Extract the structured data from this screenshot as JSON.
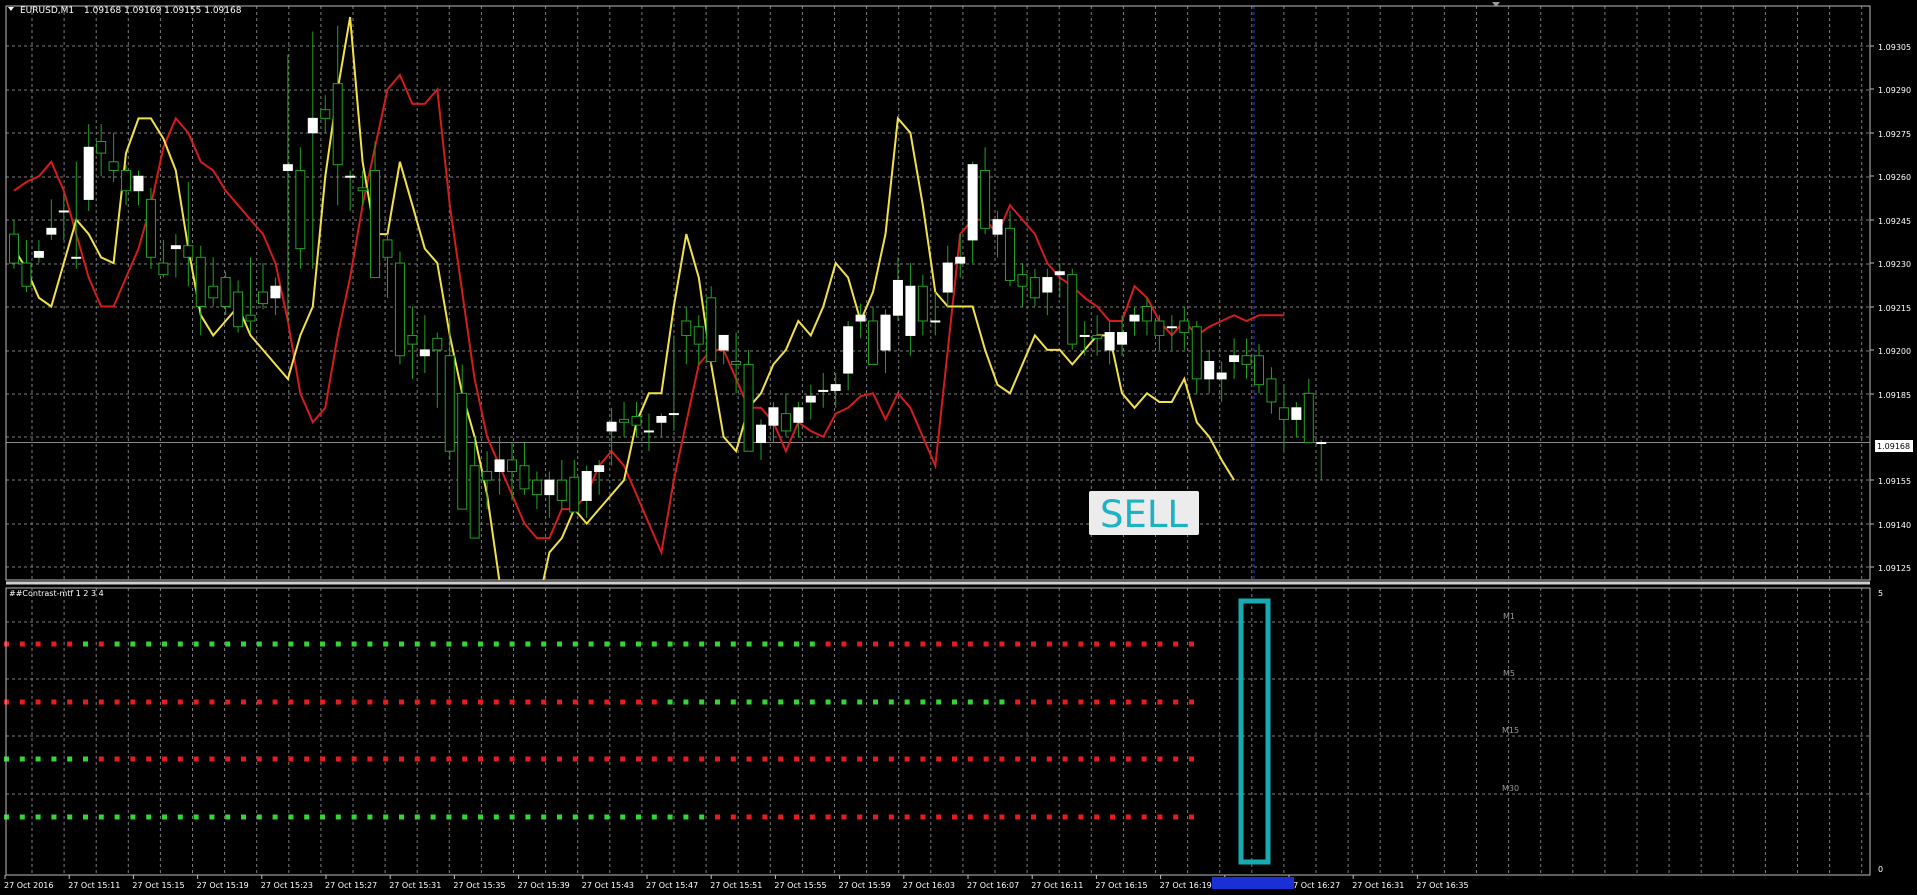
{
  "window": {
    "title": "EURUSD,M1",
    "ohlc": "1.09168 1.09169 1.09155 1.09168"
  },
  "indicator": {
    "title": "##Contrast-mtf 1 2 3 4",
    "scale_top": "5",
    "scale_bottom": "0",
    "rows": [
      {
        "label": "M1",
        "pattern": [
          "red",
          5,
          "green",
          1,
          "red",
          1,
          "green",
          45,
          "red",
          24
        ]
      },
      {
        "label": "M5",
        "pattern": [
          "red",
          42,
          "green",
          22,
          "red",
          12
        ]
      },
      {
        "label": "M15",
        "pattern": [
          "green",
          6,
          "red",
          70
        ]
      },
      {
        "label": "M30",
        "pattern": [
          "green",
          45,
          "red",
          31
        ]
      }
    ]
  },
  "price_axis": {
    "labels": [
      "1.09305",
      "1.09290",
      "1.09275",
      "1.09260",
      "1.09245",
      "1.09230",
      "1.09215",
      "1.09200",
      "1.09185",
      "1.09155",
      "1.09140",
      "1.09125"
    ],
    "current": "1.09168"
  },
  "time_axis": {
    "labels": [
      "27 Oct 2016",
      "27 Oct 15:11",
      "27 Oct 15:15",
      "27 Oct 15:19",
      "27 Oct 15:23",
      "27 Oct 15:27",
      "27 Oct 15:31",
      "27 Oct 15:35",
      "27 Oct 15:39",
      "27 Oct 15:43",
      "27 Oct 15:47",
      "27 Oct 15:51",
      "27 Oct 15:55",
      "27 Oct 15:59",
      "27 Oct 16:03",
      "27 Oct 16:07",
      "27 Oct 16:11",
      "27 Oct 16:15",
      "27 Oct 16:19",
      "27 Oct 16:23",
      "27 Oct 16:27",
      "27 Oct 16:31",
      "27 Oct 16:35"
    ]
  },
  "signal": {
    "label": "SELL"
  },
  "colors": {
    "background": "#000000",
    "grid": "#7c7c7c",
    "bull_candle": "#ffffff",
    "bear_candle": "#000000",
    "wick": "#21a321",
    "red_line": "#d31d1d",
    "yellow_line": "#f2e14a",
    "dot_red": "#e81c1c",
    "dot_green": "#33d633",
    "highlight": "#17aab3",
    "sell_text": "#1cb4c4",
    "sell_bg": "#ececec"
  },
  "chart_data": {
    "type": "candlestick",
    "symbol": "EURUSD",
    "timeframe": "M1",
    "ylim": [
      1.0912,
      1.0932
    ],
    "candles": [
      [
        1.0924,
        1.09245,
        1.09228,
        1.0923
      ],
      [
        1.0923,
        1.09238,
        1.0922,
        1.09222
      ],
      [
        1.09232,
        1.09238,
        1.0923,
        1.09234
      ],
      [
        1.0924,
        1.09252,
        1.09238,
        1.09242
      ],
      [
        1.09248,
        1.09254,
        1.09238,
        1.09248
      ],
      [
        1.09232,
        1.09265,
        1.09228,
        1.09232
      ],
      [
        1.09252,
        1.09278,
        1.09248,
        1.0927
      ],
      [
        1.09272,
        1.09278,
        1.0926,
        1.09268
      ],
      [
        1.09265,
        1.09275,
        1.09258,
        1.09262
      ],
      [
        1.09262,
        1.09264,
        1.0925,
        1.09255
      ],
      [
        1.09255,
        1.09262,
        1.0925,
        1.0926
      ],
      [
        1.09252,
        1.09256,
        1.09228,
        1.09232
      ],
      [
        1.0923,
        1.09238,
        1.09225,
        1.09226
      ],
      [
        1.09235,
        1.0924,
        1.09225,
        1.09236
      ],
      [
        1.09236,
        1.09258,
        1.09222,
        1.09232
      ],
      [
        1.09232,
        1.09236,
        1.09205,
        1.09215
      ],
      [
        1.09222,
        1.09232,
        1.09215,
        1.09218
      ],
      [
        1.09225,
        1.09227,
        1.09212,
        1.09215
      ],
      [
        1.0922,
        1.09224,
        1.09206,
        1.09208
      ],
      [
        1.09212,
        1.09232,
        1.09206,
        1.0921
      ],
      [
        1.0922,
        1.0923,
        1.09214,
        1.09216
      ],
      [
        1.09218,
        1.09225,
        1.09212,
        1.09222
      ],
      [
        1.09262,
        1.09302,
        1.0921,
        1.09264
      ],
      [
        1.09262,
        1.0927,
        1.09228,
        1.09235
      ],
      [
        1.09275,
        1.0931,
        1.09228,
        1.0928
      ],
      [
        1.09283,
        1.09288,
        1.09275,
        1.0928
      ],
      [
        1.09292,
        1.09312,
        1.0925,
        1.09264
      ],
      [
        1.0926,
        1.09262,
        1.09248,
        1.0926
      ],
      [
        1.09256,
        1.09262,
        1.0925,
        1.09255
      ],
      [
        1.09262,
        1.09272,
        1.09225,
        1.09225
      ],
      [
        1.09238,
        1.0924,
        1.09218,
        1.09232
      ],
      [
        1.0923,
        1.09234,
        1.09195,
        1.09198
      ],
      [
        1.09205,
        1.09215,
        1.0919,
        1.09202
      ],
      [
        1.09198,
        1.09212,
        1.09192,
        1.092
      ],
      [
        1.09204,
        1.09206,
        1.0918,
        1.092
      ],
      [
        1.09198,
        1.0921,
        1.09162,
        1.09165
      ],
      [
        1.09185,
        1.09195,
        1.0915,
        1.09145
      ],
      [
        1.0916,
        1.0917,
        1.09135,
        1.09135
      ],
      [
        1.09158,
        1.09165,
        1.09145,
        1.09155
      ],
      [
        1.09158,
        1.0917,
        1.0915,
        1.09162
      ],
      [
        1.09162,
        1.09168,
        1.09148,
        1.09158
      ],
      [
        1.0916,
        1.09168,
        1.0915,
        1.09152
      ],
      [
        1.09155,
        1.09158,
        1.09145,
        1.0915
      ],
      [
        1.0915,
        1.09158,
        1.09142,
        1.09155
      ],
      [
        1.09155,
        1.09162,
        1.09145,
        1.09148
      ],
      [
        1.09156,
        1.09162,
        1.09146,
        1.09144
      ],
      [
        1.09148,
        1.0916,
        1.09142,
        1.09158
      ],
      [
        1.09158,
        1.09162,
        1.0915,
        1.0916
      ],
      [
        1.09172,
        1.0918,
        1.0916,
        1.09175
      ],
      [
        1.09176,
        1.09182,
        1.0917,
        1.09175
      ],
      [
        1.09177,
        1.09182,
        1.0917,
        1.09174
      ],
      [
        1.09172,
        1.09178,
        1.09165,
        1.09172
      ],
      [
        1.09175,
        1.09178,
        1.0917,
        1.09177
      ],
      [
        1.09178,
        1.09205,
        1.09172,
        1.09178
      ],
      [
        1.0921,
        1.09215,
        1.09195,
        1.09205
      ],
      [
        1.09208,
        1.09212,
        1.09195,
        1.09202
      ],
      [
        1.09218,
        1.09222,
        1.09195,
        1.09196
      ],
      [
        1.092,
        1.09205,
        1.09195,
        1.09205
      ],
      [
        1.09196,
        1.09206,
        1.09185,
        1.09195
      ],
      [
        1.09195,
        1.092,
        1.09165,
        1.09165
      ],
      [
        1.09168,
        1.09176,
        1.09162,
        1.09174
      ],
      [
        1.09174,
        1.09182,
        1.09168,
        1.0918
      ],
      [
        1.09178,
        1.09185,
        1.0917,
        1.09172
      ],
      [
        1.09175,
        1.09182,
        1.0917,
        1.0918
      ],
      [
        1.09182,
        1.09188,
        1.09176,
        1.09184
      ],
      [
        1.09186,
        1.09192,
        1.0918,
        1.09186
      ],
      [
        1.09186,
        1.09192,
        1.0918,
        1.09188
      ],
      [
        1.09192,
        1.0921,
        1.09186,
        1.09208
      ],
      [
        1.0921,
        1.09216,
        1.09204,
        1.09212
      ],
      [
        1.0921,
        1.09215,
        1.092,
        1.09195
      ],
      [
        1.092,
        1.09214,
        1.09192,
        1.09212
      ],
      [
        1.09212,
        1.09232,
        1.0921,
        1.09224
      ],
      [
        1.09205,
        1.0923,
        1.09198,
        1.09222
      ],
      [
        1.09222,
        1.09226,
        1.09205,
        1.0921
      ],
      [
        1.0921,
        1.0922,
        1.09205,
        1.0921
      ],
      [
        1.0922,
        1.09236,
        1.09215,
        1.0923
      ],
      [
        1.0923,
        1.0924,
        1.09225,
        1.09232
      ],
      [
        1.09238,
        1.09265,
        1.0923,
        1.09264
      ],
      [
        1.09262,
        1.0927,
        1.0924,
        1.09242
      ],
      [
        1.0924,
        1.09248,
        1.09232,
        1.09245
      ],
      [
        1.09242,
        1.09248,
        1.09222,
        1.09224
      ],
      [
        1.09226,
        1.0923,
        1.09215,
        1.09222
      ],
      [
        1.09225,
        1.09228,
        1.09215,
        1.09218
      ],
      [
        1.0922,
        1.09228,
        1.09212,
        1.09225
      ],
      [
        1.09226,
        1.0923,
        1.09218,
        1.09227
      ],
      [
        1.09226,
        1.09228,
        1.092,
        1.09202
      ],
      [
        1.09205,
        1.0921,
        1.09198,
        1.09205
      ],
      [
        1.09205,
        1.09212,
        1.09198,
        1.09204
      ],
      [
        1.092,
        1.0921,
        1.09195,
        1.09206
      ],
      [
        1.09202,
        1.09212,
        1.09198,
        1.09206
      ],
      [
        1.0921,
        1.09215,
        1.09205,
        1.09212
      ],
      [
        1.09215,
        1.09218,
        1.09205,
        1.0921
      ],
      [
        1.0921,
        1.09212,
        1.092,
        1.09205
      ],
      [
        1.09208,
        1.09212,
        1.092,
        1.09208
      ],
      [
        1.0921,
        1.09215,
        1.092,
        1.09206
      ],
      [
        1.09208,
        1.0921,
        1.09185,
        1.0919
      ],
      [
        1.0919,
        1.092,
        1.09185,
        1.09196
      ],
      [
        1.0919,
        1.09196,
        1.09182,
        1.09192
      ],
      [
        1.09196,
        1.09204,
        1.0919,
        1.09198
      ],
      [
        1.09198,
        1.09204,
        1.0919,
        1.09195
      ],
      [
        1.09198,
        1.09202,
        1.09185,
        1.09188
      ],
      [
        1.0919,
        1.09194,
        1.09178,
        1.09182
      ],
      [
        1.0918,
        1.09188,
        1.09165,
        1.09176
      ],
      [
        1.09176,
        1.09182,
        1.0917,
        1.0918
      ],
      [
        1.09185,
        1.0919,
        1.09168,
        1.09168
      ],
      [
        1.09168,
        1.09169,
        1.09155,
        1.09168
      ]
    ],
    "red_line": [
      1.09255,
      1.09258,
      1.0926,
      1.09265,
      1.09255,
      1.0924,
      1.09225,
      1.09215,
      1.09215,
      1.09225,
      1.09235,
      1.0925,
      1.0927,
      1.0928,
      1.09275,
      1.09265,
      1.09262,
      1.09255,
      1.0925,
      1.09245,
      1.0924,
      1.0923,
      1.0921,
      1.09185,
      1.09175,
      1.0918,
      1.09205,
      1.09225,
      1.0925,
      1.0927,
      1.0929,
      1.09295,
      1.09285,
      1.09285,
      1.0929,
      1.0925,
      1.0922,
      1.0919,
      1.0917,
      1.0916,
      1.0915,
      1.0914,
      1.09135,
      1.09135,
      1.09145,
      1.09145,
      1.0915,
      1.0916,
      1.09165,
      1.0916,
      1.0915,
      1.0914,
      1.0913,
      1.09155,
      1.09175,
      1.09195,
      1.092,
      1.092,
      1.0919,
      1.0918,
      1.0918,
      1.09175,
      1.09165,
      1.09175,
      1.09172,
      1.0917,
      1.09178,
      1.0918,
      1.09184,
      1.09185,
      1.09176,
      1.09185,
      1.0918,
      1.0917,
      1.0916,
      1.092,
      1.0924,
      1.09245,
      1.09245,
      1.0924,
      1.0925,
      1.09245,
      1.0924,
      1.0923,
      1.09225,
      1.09222,
      1.09218,
      1.09215,
      1.0921,
      1.0921,
      1.09222,
      1.09218,
      1.0921,
      1.09205,
      1.0921,
      1.09205,
      1.09208,
      1.0921,
      1.09212,
      1.0921,
      1.09212,
      1.09212,
      1.09212
    ],
    "yellow_line": [
      1.09235,
      1.09228,
      1.09218,
      1.09215,
      1.0923,
      1.09245,
      1.0924,
      1.09232,
      1.0923,
      1.09268,
      1.0928,
      1.0928,
      1.09273,
      1.09262,
      1.09235,
      1.09212,
      1.09205,
      1.0921,
      1.09215,
      1.09205,
      1.092,
      1.09195,
      1.0919,
      1.09205,
      1.09215,
      1.0926,
      1.0929,
      1.09315,
      1.09265,
      1.0924,
      1.0924,
      1.09265,
      1.0925,
      1.09235,
      1.0923,
      1.09205,
      1.09185,
      1.0917,
      1.0915,
      1.0912,
      1.091,
      1.0908,
      1.0911,
      1.0913,
      1.09135,
      1.09145,
      1.0914,
      1.09145,
      1.0915,
      1.09155,
      1.09175,
      1.09185,
      1.09185,
      1.09215,
      1.0924,
      1.09225,
      1.09195,
      1.0917,
      1.09165,
      1.0918,
      1.09185,
      1.09195,
      1.092,
      1.0921,
      1.09205,
      1.09215,
      1.0923,
      1.09225,
      1.0921,
      1.0922,
      1.0924,
      1.0928,
      1.09275,
      1.0925,
      1.0922,
      1.09215,
      1.09215,
      1.09215,
      1.092,
      1.09188,
      1.09185,
      1.09195,
      1.09205,
      1.092,
      1.092,
      1.09195,
      1.092,
      1.09205,
      1.09205,
      1.09185,
      1.0918,
      1.09185,
      1.09182,
      1.09182,
      1.0919,
      1.09175,
      1.0917,
      1.09162,
      1.09155
    ],
    "current_price": 1.09168
  }
}
